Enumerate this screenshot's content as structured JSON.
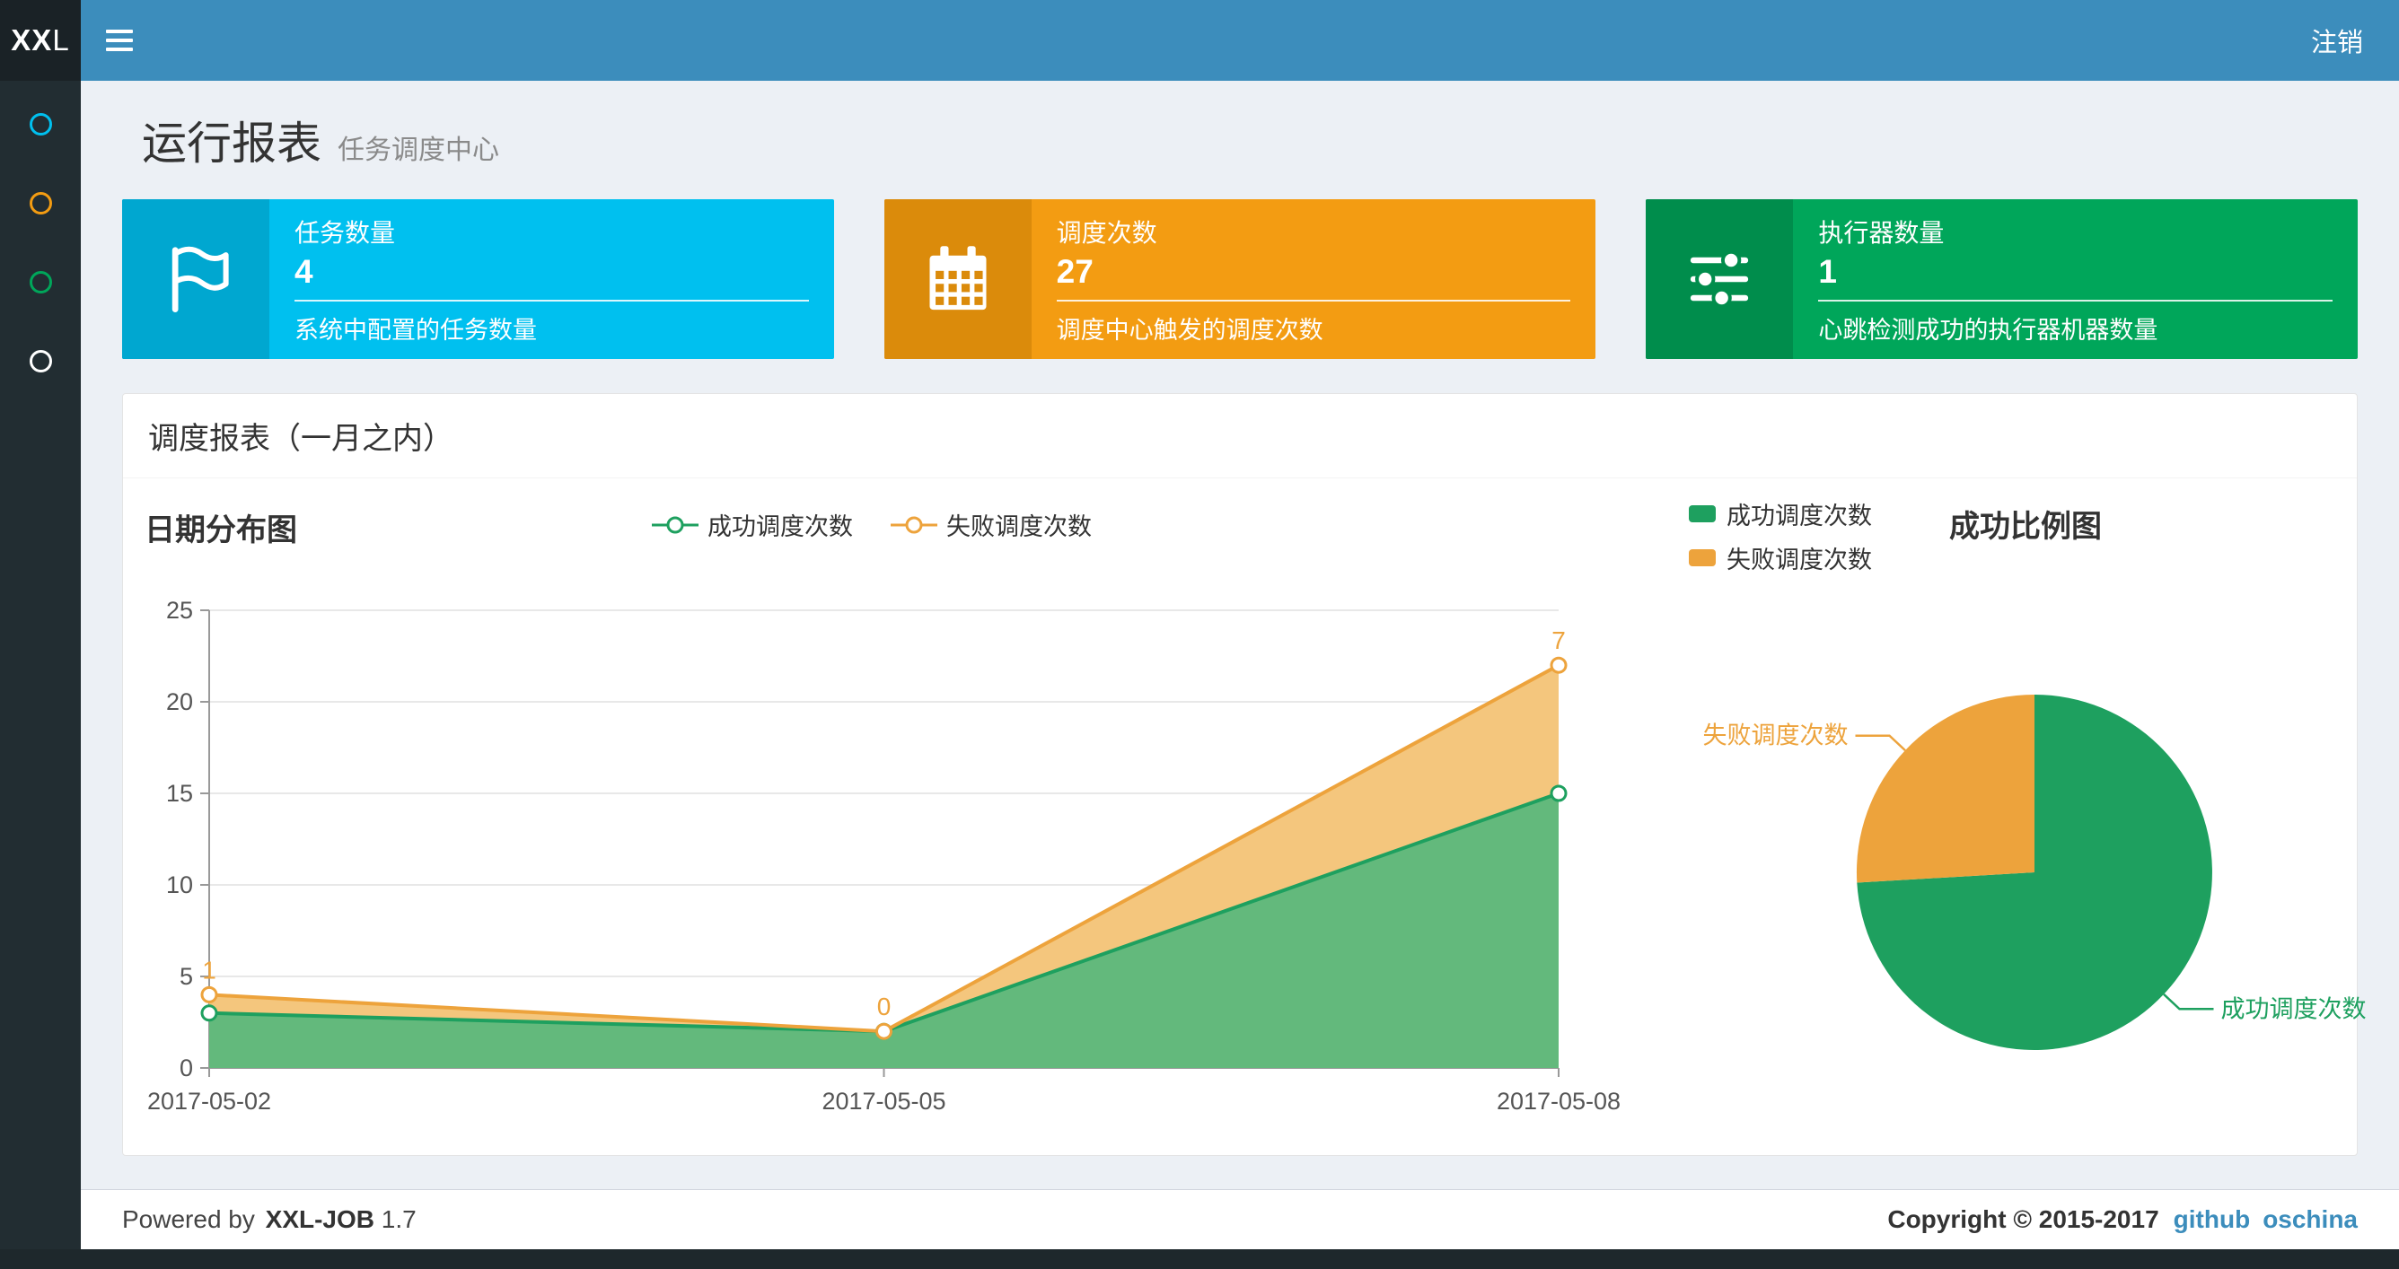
{
  "theme": {
    "navbar": "#3c8dbc",
    "sidebar": "#222d32",
    "content_bg": "#ecf0f5",
    "link": "#3c8dbc"
  },
  "navbar": {
    "logo_bold": "XX",
    "logo_light": "L",
    "logout": "注销"
  },
  "sidebar": {
    "items": [
      {
        "icon": "circle-icon",
        "color": "#00c0ef"
      },
      {
        "icon": "circle-icon",
        "color": "#f39c12"
      },
      {
        "icon": "circle-icon",
        "color": "#00a65a"
      },
      {
        "icon": "circle-icon",
        "color": "#ffffff"
      }
    ]
  },
  "page": {
    "title": "运行报表",
    "subtitle": "任务调度中心"
  },
  "info_boxes": [
    {
      "id": "tasks",
      "title": "任务数量",
      "value": "4",
      "desc": "系统中配置的任务数量",
      "color": "#00c0ef",
      "icon_bg": "#00a7d0",
      "icon": "flag-icon"
    },
    {
      "id": "triggers",
      "title": "调度次数",
      "value": "27",
      "desc": "调度中心触发的调度次数",
      "color": "#f39c12",
      "icon_bg": "#db8b0b",
      "icon": "calendar-icon"
    },
    {
      "id": "executors",
      "title": "执行器数量",
      "value": "1",
      "desc": "心跳检测成功的执行器机器数量",
      "color": "#00a65a",
      "icon_bg": "#008d4c",
      "icon": "sliders-icon"
    }
  ],
  "panel": {
    "title": "调度报表（一月之内）"
  },
  "chart_data": [
    {
      "type": "area",
      "title": "日期分布图",
      "stacked": true,
      "x": [
        "2017-05-02",
        "2017-05-05",
        "2017-05-08"
      ],
      "series": [
        {
          "name": "成功调度次数",
          "values": [
            3,
            2,
            15
          ],
          "color": "#1ea05f",
          "area_color": "#63b97c",
          "show_labels": false
        },
        {
          "name": "失败调度次数",
          "values": [
            1,
            0,
            7
          ],
          "color": "#eda33c",
          "area_color": "#f4c67d",
          "show_labels": true
        }
      ],
      "ylim": [
        0,
        25
      ],
      "yticks": [
        0,
        5,
        10,
        15,
        20,
        25
      ],
      "xlabel": "",
      "ylabel": "",
      "grid": true,
      "legend_position": "top-center"
    },
    {
      "type": "pie",
      "title": "成功比例图",
      "slices": [
        {
          "name": "成功调度次数",
          "value": 20,
          "color": "#1ea05f"
        },
        {
          "name": "失败调度次数",
          "value": 7,
          "color": "#eda33c"
        }
      ],
      "legend_position": "top-left"
    }
  ],
  "footer": {
    "powered_by": "Powered by",
    "brand": "XXL-JOB",
    "version": "1.7",
    "copyright": "Copyright © 2015-2017",
    "links": [
      {
        "label": "github"
      },
      {
        "label": "oschina"
      }
    ]
  }
}
